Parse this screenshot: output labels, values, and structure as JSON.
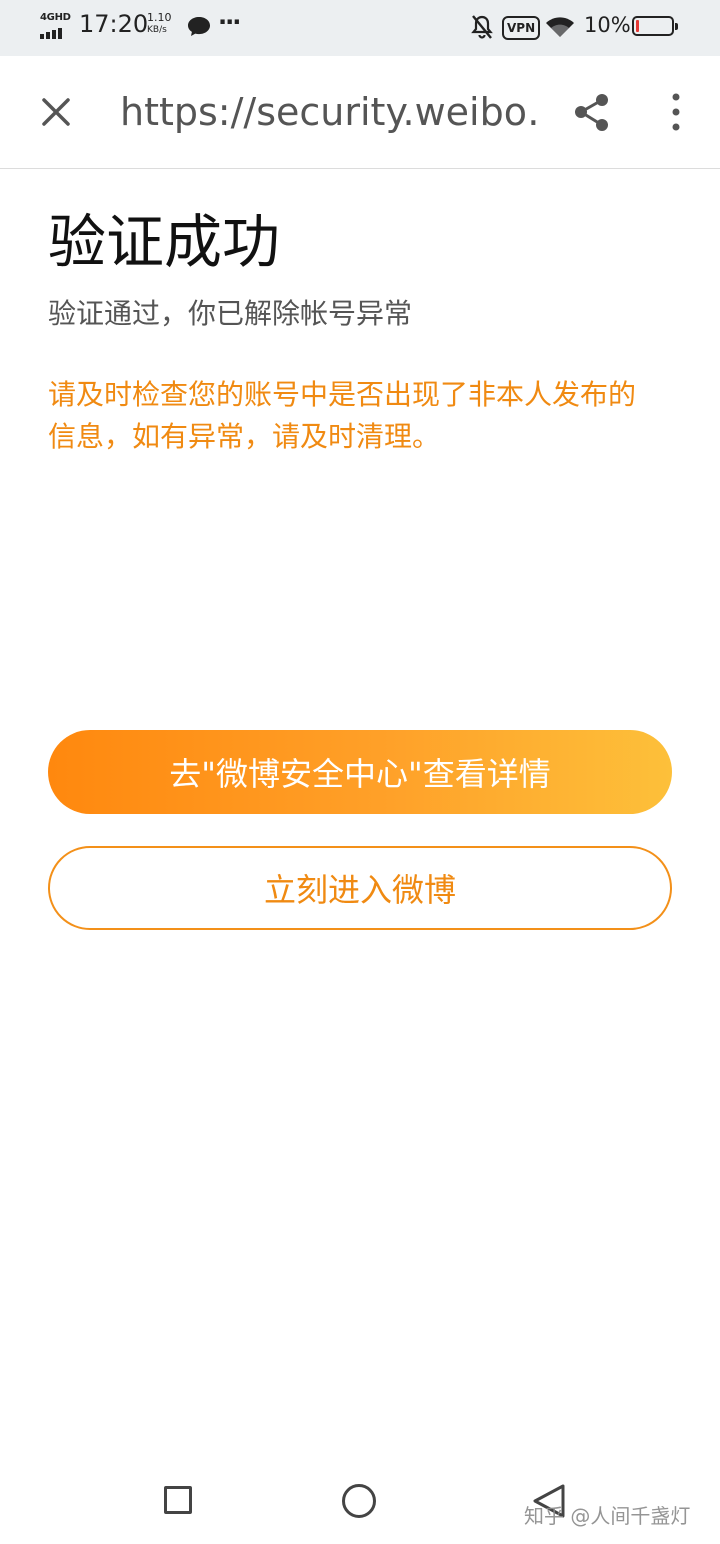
{
  "status_bar": {
    "network": "4GHD",
    "time": "17:20",
    "speed_value": "1.10",
    "speed_unit": "KB/s",
    "vpn_label": "VPN",
    "battery": "10%",
    "battery_level_percent": 10,
    "icons": [
      "signal-bars-icon",
      "wechat-icon",
      "more-notifications-icon",
      "muted-bell-icon",
      "vpn-badge",
      "wifi-icon",
      "battery-icon"
    ]
  },
  "toolbar": {
    "url": "https://security.weibo…",
    "icons": [
      "close-icon",
      "share-icon",
      "more-vert-icon"
    ]
  },
  "main": {
    "title": "验证成功",
    "subtitle": "验证通过，你已解除帐号异常",
    "warning": "请及时检查您的账号中是否出现了非本人发布的信息，如有异常，请及时清理。"
  },
  "actions": {
    "primary_label": "去\"微博安全中心\"查看详情",
    "secondary_label": "立刻进入微博"
  },
  "nav_bar": {
    "icons": [
      "recent-apps-icon",
      "home-icon",
      "back-icon"
    ],
    "watermark": "知乎 @人间千盏灯"
  },
  "colors": {
    "accent_orange": "#f08a12",
    "gradient_start": "#ff880e",
    "gradient_end": "#fdc03a",
    "status_bar_bg": "#eceff1",
    "battery_low": "#e53935"
  }
}
